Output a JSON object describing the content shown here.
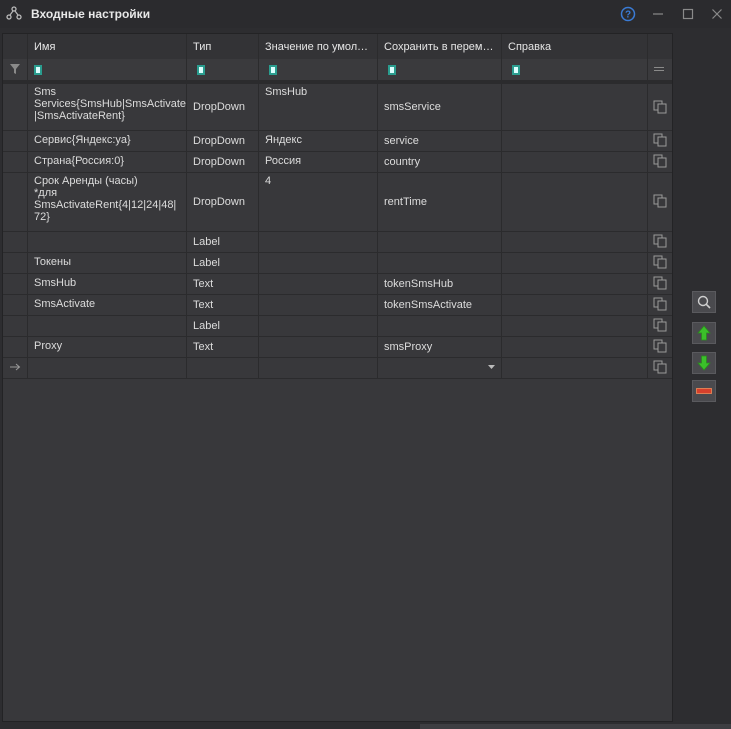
{
  "window": {
    "title": "Входные настройки"
  },
  "columns": [
    "Имя",
    "Тип",
    "Значение по умолч...",
    "Сохранить в переме...",
    "Справка"
  ],
  "rows": [
    {
      "name": "Sms\nServices{SmsHub|SmsActivate\n|SmsActivateRent}",
      "type": "DropDown",
      "default": "SmsHub",
      "variable": "smsService",
      "help": ""
    },
    {
      "name": "Сервис{Яндекс:ya}",
      "type": "DropDown",
      "default": "Яндекс",
      "variable": "service",
      "help": ""
    },
    {
      "name": "Страна{Россия:0}",
      "type": "DropDown",
      "default": "Россия",
      "variable": "country",
      "help": ""
    },
    {
      "name": "Срок Аренды (часы)\n*для\nSmsActivateRent{4|12|24|48|\n72}",
      "type": "DropDown",
      "default": "4",
      "variable": "rentTime",
      "help": ""
    },
    {
      "name": "",
      "type": "Label",
      "default": "",
      "variable": "",
      "help": ""
    },
    {
      "name": "Токены",
      "type": "Label",
      "default": "",
      "variable": "",
      "help": ""
    },
    {
      "name": "SmsHub",
      "type": "Text",
      "default": "",
      "variable": "tokenSmsHub",
      "help": ""
    },
    {
      "name": "SmsActivate",
      "type": "Text",
      "default": "",
      "variable": "tokenSmsActivate",
      "help": ""
    },
    {
      "name": "",
      "type": "Label",
      "default": "",
      "variable": "",
      "help": ""
    },
    {
      "name": "Proxy",
      "type": "Text",
      "default": "",
      "variable": "smsProxy",
      "help": ""
    }
  ],
  "colors": {
    "accent_help": "#3a7bd5",
    "arrow_green": "#3bbf2a",
    "remove_red": "#d6402c"
  },
  "icons": {
    "app": "nodes-icon",
    "help": "help-icon",
    "minimize": "minimize-icon",
    "maximize": "maximize-icon",
    "close": "close-icon",
    "filter": "filter-icon",
    "copy": "copy-icon",
    "search": "search-icon",
    "move_up": "arrow-up-icon",
    "move_down": "arrow-down-icon",
    "remove": "remove-icon"
  }
}
